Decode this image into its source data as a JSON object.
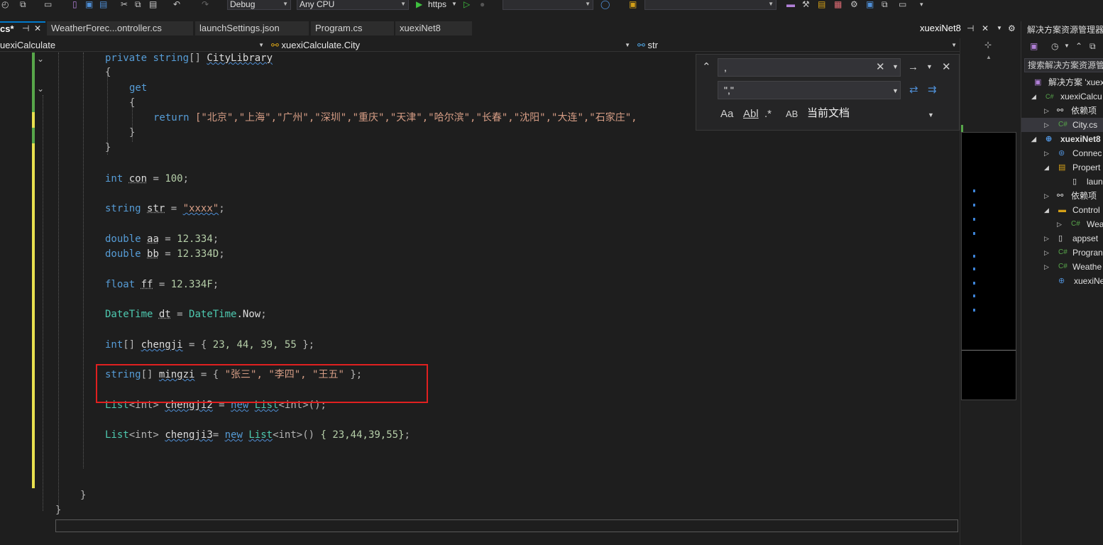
{
  "toolbar": {
    "config": "Debug",
    "platform": "Any CPU",
    "run_target": "https",
    "empty_combo_1": "",
    "empty_combo_2": ""
  },
  "tabs": [
    {
      "label": "cs*",
      "active": true
    },
    {
      "label": "WeatherForec...ontroller.cs",
      "active": false
    },
    {
      "label": "launchSettings.json",
      "active": false
    },
    {
      "label": "Program.cs",
      "active": false
    },
    {
      "label": "xuexiNet8",
      "active": false
    }
  ],
  "right_tab": {
    "label": "xuexiNet8"
  },
  "nav": {
    "project": "uexiCalculate",
    "type": "xuexiCalculate.City",
    "member": "str"
  },
  "find": {
    "search_value": ",",
    "replace_value": "\",\"",
    "scope": "当前文档",
    "match_case": "Aa",
    "whole_word": "Abl",
    "regex": ".*",
    "preserve_case": "AB"
  },
  "code": {
    "l1": {
      "kw": "private",
      "ty": "string",
      "br": "[]",
      "name": "CityLibrary"
    },
    "open1": "{",
    "get": "get",
    "open2": "{",
    "ret_kw": "return",
    "ret_value": " [\"北京\",\"上海\",\"广州\",\"深圳\",\"重庆\",\"天津\",\"哈尔滨\",\"长春\",\"沈阳\",\"大连\",\"石家庄\",",
    "close2": "}",
    "close1": "}",
    "int_line": {
      "ty": "int",
      "name": "con",
      "rest": " = ",
      "val": "100",
      "end": ";"
    },
    "str_line": {
      "ty": "string",
      "name": "str",
      "rest": " = ",
      "val": "\"xxxx\"",
      "end": ";"
    },
    "aa_line": {
      "ty": "double",
      "name": "aa",
      "rest": " = ",
      "val": "12.334",
      "end": ";"
    },
    "bb_line": {
      "ty": "double",
      "name": "bb",
      "rest": " = ",
      "val": "12.334D",
      "end": ";"
    },
    "ff_line": {
      "ty": "float",
      "name": "ff",
      "rest": " = ",
      "val": "12.334F",
      "end": ";"
    },
    "dt_line": {
      "ty": "DateTime",
      "name": "dt",
      "rest": " = ",
      "cls": "DateTime",
      "mem": ".Now",
      "end": ";"
    },
    "arr_line": {
      "ty": "int",
      "br": "[]",
      "name": "chengji",
      "rest": " = { ",
      "vals": "23, 44, 39, 55",
      "end": " };"
    },
    "names_line": {
      "ty": "string",
      "br": "[]",
      "name": "mingzi",
      "rest": " = { ",
      "vals": "\"张三\", \"李四\", \"王五\"",
      "end": " };"
    },
    "list2_line": {
      "ty": "List",
      "gen": "<int>",
      "name": "chengji2",
      "rest": " = ",
      "new": "new",
      "ty2": "List",
      "gen2": "<int>",
      "end": "();"
    },
    "list3_line": {
      "ty": "List",
      "gen": "<int>",
      "name": "chengji3",
      "rest": "= ",
      "new": "new",
      "ty2": "List",
      "gen2": "<int>",
      "paren": "() ",
      "vals": "{ 23,44,39,55}",
      "end": ";"
    },
    "close_class": "}",
    "close_ns": "}"
  },
  "solution": {
    "title": "解决方案资源管理器",
    "search": "搜索解决方案资源管理",
    "items": [
      {
        "label": "解决方案 'xuex",
        "icon": "solution-icon"
      },
      {
        "label": "xuexiCalcu",
        "icon": "csproj-icon"
      },
      {
        "label": "依赖项",
        "icon": "dependencies-icon"
      },
      {
        "label": "City.cs",
        "icon": "csharp-file-icon"
      },
      {
        "label": "xuexiNet8",
        "icon": "web-project-icon"
      },
      {
        "label": "Connec",
        "icon": "connected-services-icon"
      },
      {
        "label": "Propert",
        "icon": "properties-icon"
      },
      {
        "label": "laun",
        "icon": "json-file-icon"
      },
      {
        "label": "依赖项",
        "icon": "dependencies-icon"
      },
      {
        "label": "Control",
        "icon": "folder-icon"
      },
      {
        "label": "Wea",
        "icon": "csharp-file-icon"
      },
      {
        "label": "appset",
        "icon": "json-file-icon"
      },
      {
        "label": "Progran",
        "icon": "csharp-file-icon"
      },
      {
        "label": "Weathe",
        "icon": "csharp-file-icon"
      },
      {
        "label": "xuexiNe",
        "icon": "http-file-icon"
      }
    ],
    "csharp_badge": "C#"
  }
}
